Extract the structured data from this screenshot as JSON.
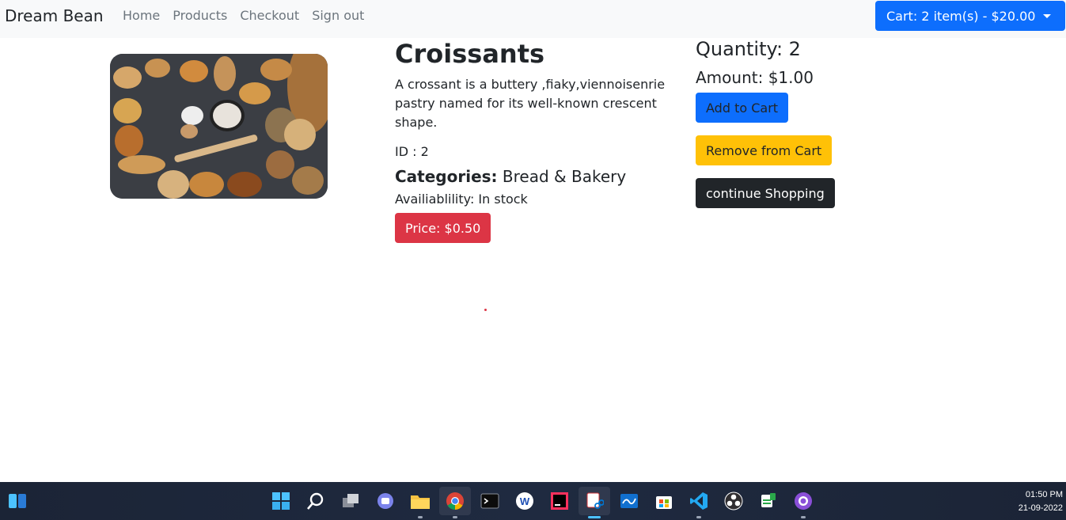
{
  "navbar": {
    "brand": "Dream Bean",
    "links": [
      "Home",
      "Products",
      "Checkout",
      "Sign out"
    ],
    "cart_label": "Cart: 2 item(s) - $20.00"
  },
  "product": {
    "title": "Croissants",
    "description": "A crossant is a buttery ,fiaky,viennoisenrie pastry named for its well-known crescent shape.",
    "id_text": "ID : 2",
    "categories_label": "Categories:",
    "categories_value": "Bread & Bakery",
    "availability": "Availiablility: In stock",
    "price": "Price: $0.50"
  },
  "cart_panel": {
    "quantity": "Quantity: 2",
    "amount": "Amount: $1.00",
    "add_label": "Add to Cart",
    "remove_label": "Remove from Cart",
    "continue_label": "continue Shopping"
  },
  "taskbar": {
    "time": "01:50 PM",
    "date": "21-09-2022",
    "icons": [
      "start-icon",
      "search-icon",
      "task-view-icon",
      "chat-icon",
      "file-explorer-icon",
      "chrome-icon",
      "terminal-icon",
      "app-w-icon",
      "intellij-icon",
      "snipping-tool-icon",
      "whiteboard-icon",
      "store-icon",
      "vscode-icon",
      "obs-icon",
      "pgadmin-icon",
      "github-desktop-icon"
    ]
  },
  "colors": {
    "primary": "#0d6efd",
    "warning": "#ffc107",
    "danger": "#dc3545",
    "dark": "#212529"
  }
}
